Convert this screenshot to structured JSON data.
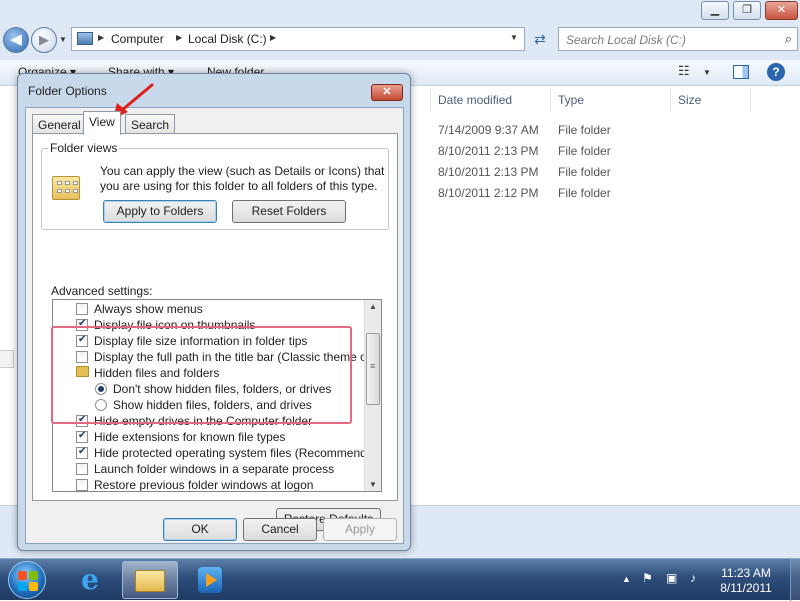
{
  "explorer": {
    "breadcrumb": [
      "Computer",
      "Local Disk (C:)"
    ],
    "search_placeholder": "Search Local Disk (C:)",
    "toolbar": {
      "organize": "Organize ▾",
      "share_with": "Share with ▾",
      "new_folder": "New folder"
    },
    "columns": {
      "date_modified": "Date modified",
      "type": "Type",
      "size": "Size"
    },
    "rows": [
      {
        "date": "7/14/2009 9:37 AM",
        "type": "File folder"
      },
      {
        "date": "8/10/2011 2:13 PM",
        "type": "File folder"
      },
      {
        "date": "8/10/2011 2:13 PM",
        "type": "File folder"
      },
      {
        "date": "8/10/2011 2:12 PM",
        "type": "File folder"
      }
    ]
  },
  "dialog": {
    "title": "Folder Options",
    "tabs": [
      "General",
      "View",
      "Search"
    ],
    "active_tab": "View",
    "folder_views": {
      "legend": "Folder views",
      "description": "You can apply the view (such as Details or Icons) that you are using for this folder to all folders of this type.",
      "apply_button": "Apply to Folders",
      "reset_button": "Reset Folders"
    },
    "advanced_label": "Advanced settings:",
    "advanced_items": [
      {
        "kind": "checkbox",
        "checked": false,
        "label": "Always show menus"
      },
      {
        "kind": "checkbox",
        "checked": true,
        "label": "Display file icon on thumbnails"
      },
      {
        "kind": "checkbox",
        "checked": true,
        "label": "Display file size information in folder tips"
      },
      {
        "kind": "checkbox",
        "checked": false,
        "label": "Display the full path in the title bar (Classic theme only)"
      },
      {
        "kind": "folder",
        "label": "Hidden files and folders"
      },
      {
        "kind": "radio",
        "checked": true,
        "label": "Don't show hidden files, folders, or drives"
      },
      {
        "kind": "radio",
        "checked": false,
        "label": "Show hidden files, folders, and drives"
      },
      {
        "kind": "checkbox",
        "checked": true,
        "label": "Hide empty drives in the Computer folder"
      },
      {
        "kind": "checkbox",
        "checked": true,
        "label": "Hide extensions for known file types"
      },
      {
        "kind": "checkbox",
        "checked": true,
        "label": "Hide protected operating system files (Recommended)"
      },
      {
        "kind": "checkbox",
        "checked": false,
        "label": "Launch folder windows in a separate process"
      },
      {
        "kind": "checkbox",
        "checked": false,
        "label": "Restore previous folder windows at logon"
      }
    ],
    "restore_defaults": "Restore Defaults",
    "ok": "OK",
    "cancel": "Cancel",
    "apply": "Apply"
  },
  "annotation": {
    "arrow_color": "#e0201b",
    "highlight_color": "#e36a82"
  },
  "taskbar": {
    "time": "11:23 AM",
    "date": "8/11/2011",
    "apps": [
      "internet-explorer-icon",
      "windows-explorer-icon",
      "media-player-icon"
    ],
    "active_app": "windows-explorer-icon"
  }
}
